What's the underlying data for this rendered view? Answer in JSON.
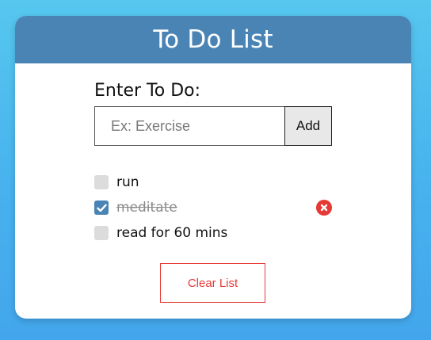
{
  "app": {
    "title": "To Do List"
  },
  "entry": {
    "label": "Enter To Do:",
    "placeholder": "Ex: Exercise",
    "value": "",
    "add_label": "Add"
  },
  "todos": [
    {
      "text": "run",
      "checked": false
    },
    {
      "text": "meditate",
      "checked": true
    },
    {
      "text": "read for 60 mins",
      "checked": false
    }
  ],
  "actions": {
    "clear_label": "Clear List"
  },
  "colors": {
    "header": "#4a84b5",
    "accent": "#4a84b5",
    "danger": "#e53935",
    "background_top": "#56c7ef",
    "background_bottom": "#43a6ec"
  },
  "icons": {
    "check": "checkmark-icon",
    "delete": "close-circle-icon"
  }
}
